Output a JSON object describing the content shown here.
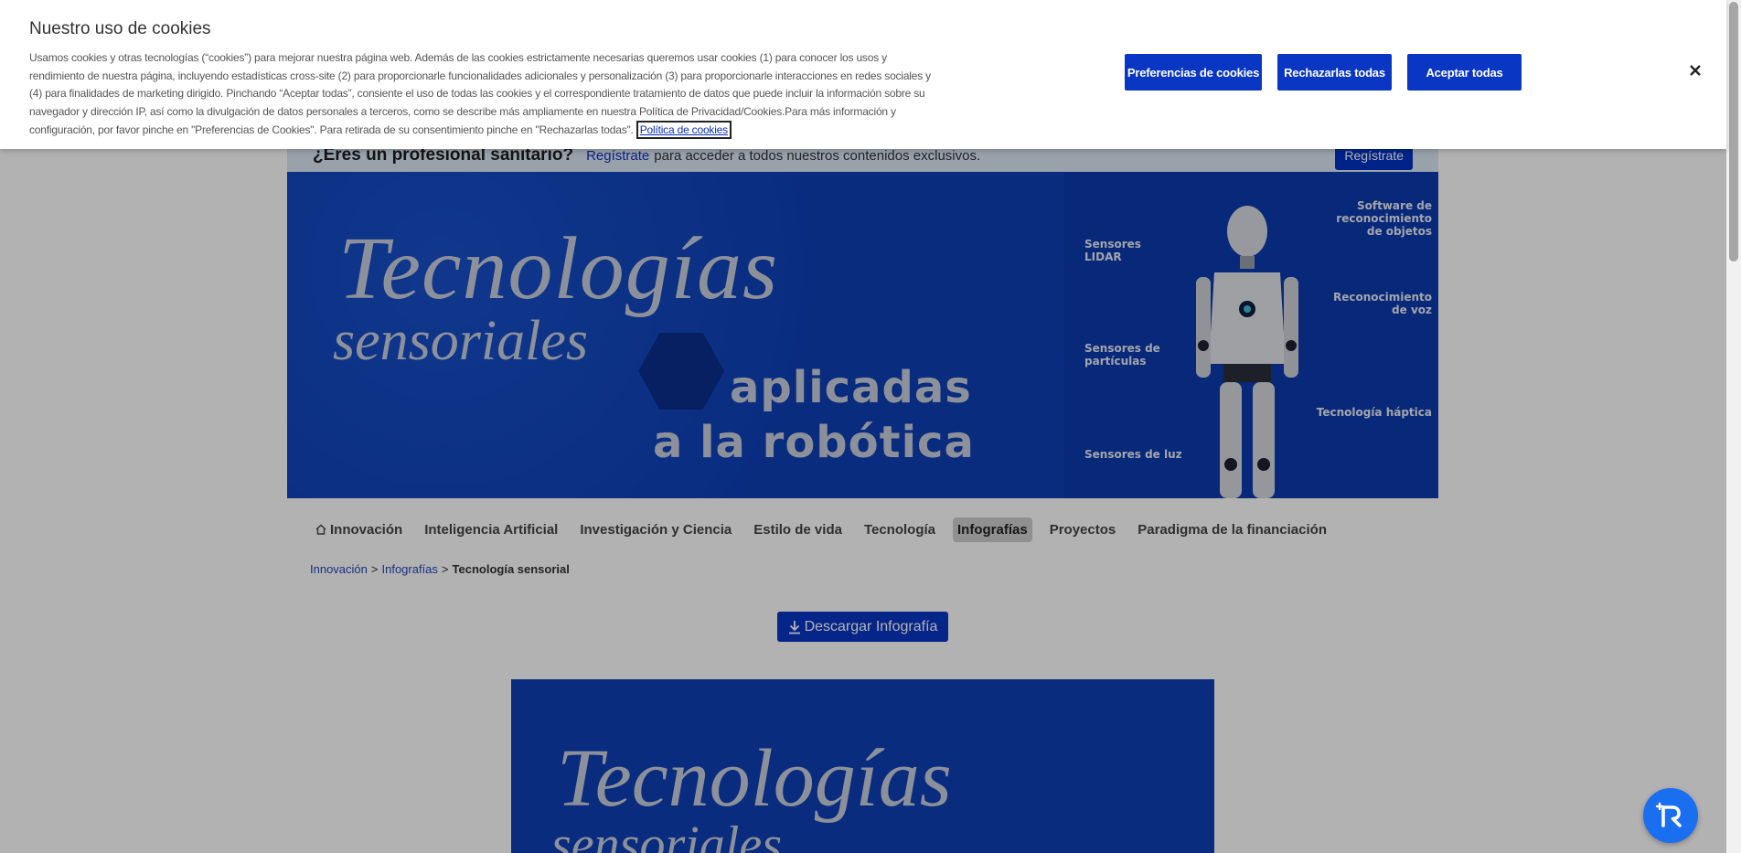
{
  "pro_bar": {
    "question": "¿Eres un profesional sanitario?",
    "link": "Regístrate",
    "rest": "para acceder a todos nuestros contenidos exclusivos.",
    "button": "Regístrate"
  },
  "hero": {
    "title_line1": "Tecnologías",
    "title_line2": "sensoriales",
    "title_line3": "aplicadas",
    "title_line4": "a la robótica",
    "panel": {
      "label_lidar": "Sensores LIDAR",
      "label_particles": "Sensores de partículas",
      "label_light": "Sensores de luz",
      "label_software": "Software de reconocimiento de objetos",
      "label_voice": "Reconocimiento de voz",
      "label_haptic": "Tecnología háptica"
    }
  },
  "menu": {
    "items": [
      {
        "label": "Innovación"
      },
      {
        "label": "Inteligencia Artificial"
      },
      {
        "label": "Investigación y Ciencia"
      },
      {
        "label": "Estilo de vida"
      },
      {
        "label": "Tecnología"
      },
      {
        "label": "Infografías"
      },
      {
        "label": "Proyectos"
      },
      {
        "label": "Paradigma de la financiación"
      }
    ],
    "active": "Infografías"
  },
  "breadcrumb": {
    "items": [
      "Innovación",
      "Infografías"
    ],
    "separator": ">",
    "current": "Tecnología sensorial"
  },
  "download": {
    "label": "Descargar Infografía"
  },
  "infographic": {
    "title_line1": "Tecnologías",
    "title_line2": "sensoriales"
  },
  "cookie": {
    "title": "Nuestro uso de cookies",
    "text": "Usamos cookies y otras tecnologías (“cookies”) para mejorar nuestra página web. Además de las cookies estrictamente necesarias queremos usar cookies (1) para conocer los usos y rendimiento de nuestra página, incluyendo estadísticas cross-site (2) para proporcionarle funcionalidades adicionales y personalización (3) para proporcionarle interacciones en redes sociales y (4) para finalidades de marketing dirigido. Pinchando “Aceptar todas”, consiente el uso de todas las cookies y el correspondiente tratamiento de datos que puede incluir la información sobre su navegador y dirección IP, así como la divulgación de datos personales a terceros, como se describe más ampliamente en nuestra Política de Privacidad/Cookies.Para más información y configuración, por favor pinche en \"Preferencias de Cookies\". Para retirada de su consentimiento pinche en \"Rechazarlas todas\".",
    "policy_link": "Política de cookies",
    "btn_preferences": "Preferencias de cookies",
    "btn_reject": "Rechazarlas todas",
    "btn_accept": "Aceptar todas"
  },
  "colors": {
    "accent": "#0a36c4",
    "hero_bg": "#0d3fb6"
  },
  "icons": [
    "home-icon",
    "download-icon",
    "close-icon",
    "chat-assistant-icon"
  ]
}
